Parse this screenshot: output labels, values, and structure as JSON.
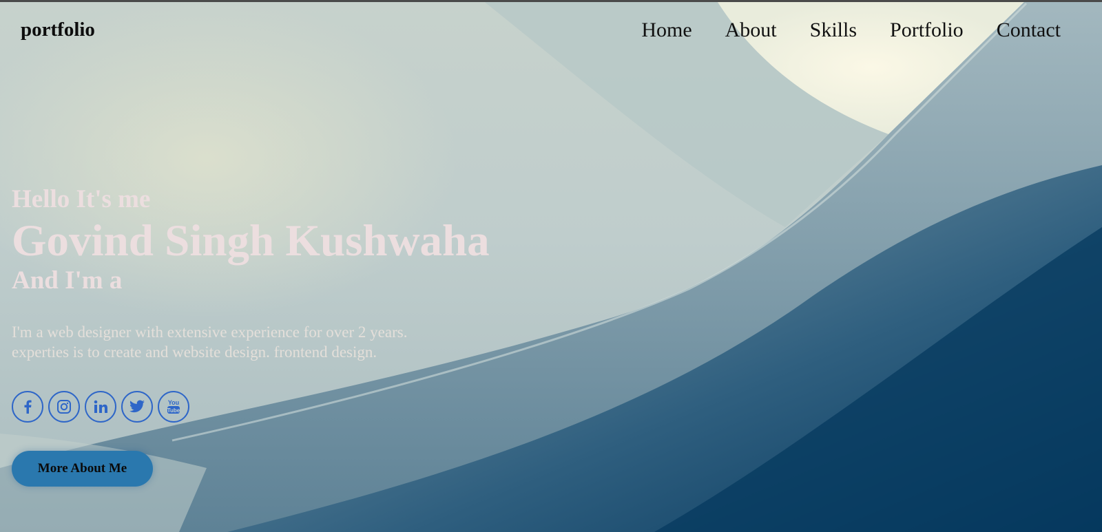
{
  "header": {
    "logo": "portfolio",
    "nav": [
      "Home",
      "About",
      "Skills",
      "Portfolio",
      "Contact"
    ]
  },
  "hero": {
    "greeting": "Hello It's me",
    "name": "Govind Singh Kushwaha",
    "role_prefix": "And I'm a",
    "description_line1": "I'm a web designer with extensive experience for over 2 years.",
    "description_line2": "experties is to create and website design. frontend design.",
    "cta_label": "More About Me"
  },
  "socials": [
    {
      "name": "facebook-icon"
    },
    {
      "name": "instagram-icon"
    },
    {
      "name": "linkedin-icon"
    },
    {
      "name": "twitter-icon"
    },
    {
      "name": "youtube-icon"
    }
  ],
  "colors": {
    "accent": "#2a78ae",
    "icon_blue": "#2e66c8",
    "hero_text": "#ecdedf"
  }
}
